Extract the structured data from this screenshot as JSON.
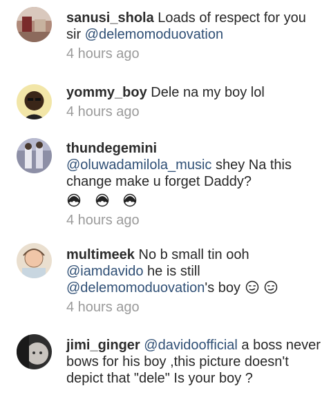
{
  "comments": [
    {
      "username": "sanusi_shola",
      "text": "Loads of respect for you sir",
      "mention": "@delemomoduovation",
      "time": "4 hours ago"
    },
    {
      "username": "yommy_boy",
      "text": "Dele na my boy lol",
      "time": "4 hours ago"
    },
    {
      "username": "thundegemini",
      "mention": "@oluwadamilola_music",
      "text": "shey Na this change make u forget Daddy?",
      "emoji": [
        "ghost-face-emoji",
        "ghost-face-emoji",
        "ghost-face-emoji"
      ],
      "time": "4 hours ago"
    },
    {
      "username": "multimeek",
      "text_a": "No b small tin ooh",
      "mention_a": "@iamdavido",
      "text_b": "he is still",
      "mention_b": "@delemomoduovation",
      "text_c": "'s boy",
      "emoji": [
        "smirk-face-emoji",
        "smirk-face-emoji"
      ],
      "time": "4 hours ago"
    },
    {
      "username": "jimi_ginger",
      "mention": "@davidoofficial",
      "text": "a boss never bows for his boy ,this picture doesn't depict that \"dele\" Is your boy ?"
    }
  ]
}
